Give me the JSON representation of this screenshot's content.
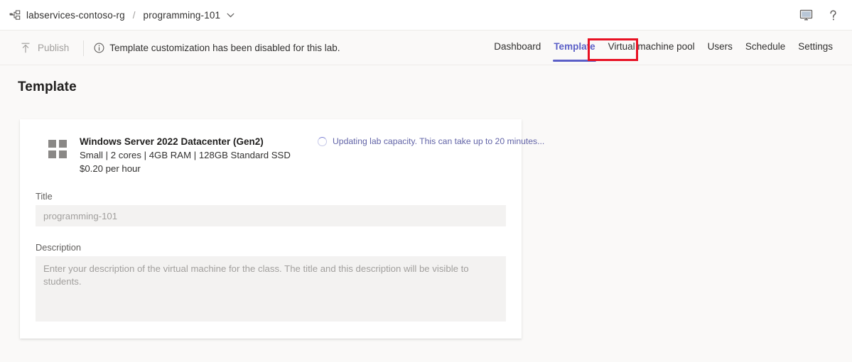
{
  "topbar": {
    "breadcrumb": {
      "resource_group_icon": "resource-group-icon",
      "resource_group": "labservices-contoso-rg",
      "separator": "/",
      "current": "programming-101",
      "chevron_icon": "chevron-down-icon"
    },
    "actions": [
      {
        "name": "display-icon",
        "label": "Display"
      },
      {
        "name": "help-icon",
        "label": "?"
      }
    ]
  },
  "commandbar": {
    "publish": {
      "label": "Publish",
      "icon": "publish-upload-icon",
      "disabled": true
    },
    "notice": {
      "icon": "info-circle-icon",
      "text": "Template customization has been disabled for this lab."
    }
  },
  "tabs": {
    "items": [
      {
        "label": "Dashboard",
        "active": false
      },
      {
        "label": "Template",
        "active": true
      },
      {
        "label": "Virtual machine pool",
        "active": false
      },
      {
        "label": "Users",
        "active": false
      },
      {
        "label": "Schedule",
        "active": false
      },
      {
        "label": "Settings",
        "active": false
      }
    ],
    "active_accent_color": "#5b5fc7",
    "highlight_box_color": "#e81123"
  },
  "page": {
    "title": "Template"
  },
  "card": {
    "vm": {
      "icon": "windows-logo-icon",
      "name": "Windows Server 2022 Datacenter (Gen2)",
      "specs": "Small | 2 cores | 4GB RAM | 128GB Standard SSD",
      "price": "$0.20 per hour"
    },
    "status": {
      "icon": "spinner-icon",
      "text": "Updating lab capacity. This can take up to 20 minutes...",
      "color": "#6264a7"
    },
    "fields": {
      "title": {
        "label": "Title",
        "value": "programming-101",
        "placeholder": "programming-101"
      },
      "description": {
        "label": "Description",
        "value": "",
        "placeholder": "Enter your description of the virtual machine for the class. The title and this description will be visible to students."
      }
    }
  }
}
